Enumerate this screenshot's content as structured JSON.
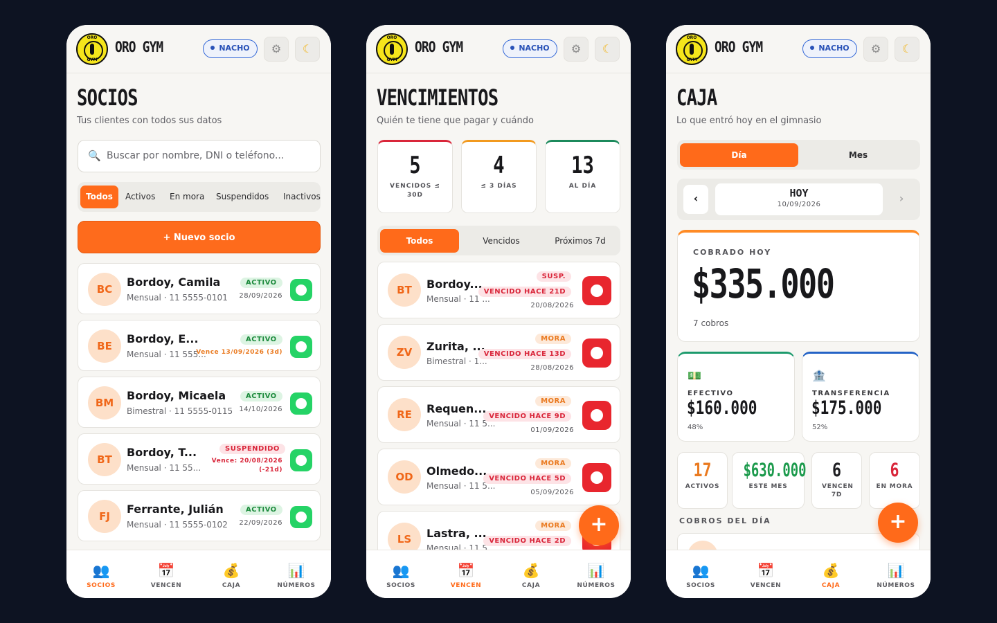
{
  "app": {
    "brand": "ORO GYM",
    "user": "NACHO",
    "logo_top": "ORO",
    "logo_bottom": "GYM"
  },
  "nav": [
    "SOCIOS",
    "VENCEN",
    "CAJA",
    "NÚMEROS"
  ],
  "socios": {
    "title": "SOCIOS",
    "subtitle": "Tus clientes con todos sus datos",
    "search_placeholder": "Buscar por nombre, DNI o teléfono...",
    "filters": [
      "Todos",
      "Activos",
      "En mora",
      "Suspendidos",
      "Inactivos"
    ],
    "new_button": "+ Nuevo socio",
    "members": [
      {
        "initials": "BC",
        "name": "Bordoy, Camila",
        "meta": "Mensual · 11 5555-0101",
        "status": "ACTIVO",
        "date": "28/09/2026"
      },
      {
        "initials": "BE",
        "name": "Bordoy, E...",
        "meta": "Mensual · 11 555...",
        "status": "ACTIVO",
        "date": "Vence 13/09/2026 (3d)"
      },
      {
        "initials": "BM",
        "name": "Bordoy, Micaela",
        "meta": "Bimestral · 11 5555-0115",
        "status": "ACTIVO",
        "date": "14/10/2026"
      },
      {
        "initials": "BT",
        "name": "Bordoy, T...",
        "meta": "Mensual · 11 55...",
        "status": "SUSPENDIDO",
        "date": "Vence: 20/08/2026",
        "date2": "(-21d)"
      },
      {
        "initials": "FJ",
        "name": "Ferrante, Julián",
        "meta": "Mensual · 11 5555-0102",
        "status": "ACTIVO",
        "date": "22/09/2026"
      }
    ]
  },
  "vencimientos": {
    "title": "VENCIMIENTOS",
    "subtitle": "Quién te tiene que pagar y cuándo",
    "stats": [
      {
        "value": "5",
        "label": "VENCIDOS ≤ 30D",
        "color": "#d9263a"
      },
      {
        "value": "4",
        "label": "≤ 3 DÍAS",
        "color": "#f29a1f"
      },
      {
        "value": "13",
        "label": "AL DÍA",
        "color": "#1c8a5c"
      }
    ],
    "tabs": [
      "Todos",
      "Vencidos",
      "Próximos 7d"
    ],
    "items": [
      {
        "initials": "BT",
        "name": "Bordoy...",
        "meta": "Mensual · 11 ...",
        "status": "SUSP.",
        "due": "VENCIDO HACE 21D",
        "date": "20/08/2026"
      },
      {
        "initials": "ZV",
        "name": "Zurita, ...",
        "meta": "Bimestral · 1...",
        "status": "MORA",
        "due": "VENCIDO HACE 13D",
        "date": "28/08/2026"
      },
      {
        "initials": "RE",
        "name": "Requen...",
        "meta": "Mensual · 11 5...",
        "status": "MORA",
        "due": "VENCIDO HACE 9D",
        "date": "01/09/2026"
      },
      {
        "initials": "OD",
        "name": "Olmedo...",
        "meta": "Mensual · 11 5...",
        "status": "MORA",
        "due": "VENCIDO HACE 5D",
        "date": "05/09/2026"
      },
      {
        "initials": "LS",
        "name": "Lastra, ...",
        "meta": "Mensual · 11 5...",
        "status": "MORA",
        "due": "VENCIDO HACE 2D",
        "date": ""
      }
    ]
  },
  "caja": {
    "title": "CAJA",
    "subtitle": "Lo que entró hoy en el gimnasio",
    "tabs": [
      "Día",
      "Mes"
    ],
    "date_label": "HOY",
    "date": "10/09/2026",
    "collected_label": "COBRADO HOY",
    "collected": "$335.000",
    "collected_count": "7 cobros",
    "efectivo": {
      "label": "EFECTIVO",
      "value": "$160.000",
      "pct": "48%"
    },
    "transferencia": {
      "label": "TRANSFERENCIA",
      "value": "$175.000",
      "pct": "52%"
    },
    "mini": [
      {
        "value": "17",
        "label": "ACTIVOS",
        "color": "#ea7a20"
      },
      {
        "value": "$630.000",
        "label": "ESTE MES",
        "color": "#1c9a4c"
      },
      {
        "value": "6",
        "label": "VENCEN 7D",
        "color": "#18181b"
      },
      {
        "value": "6",
        "label": "EN MORA",
        "color": "#d9263a"
      }
    ],
    "section": "COBROS DEL DÍA"
  }
}
